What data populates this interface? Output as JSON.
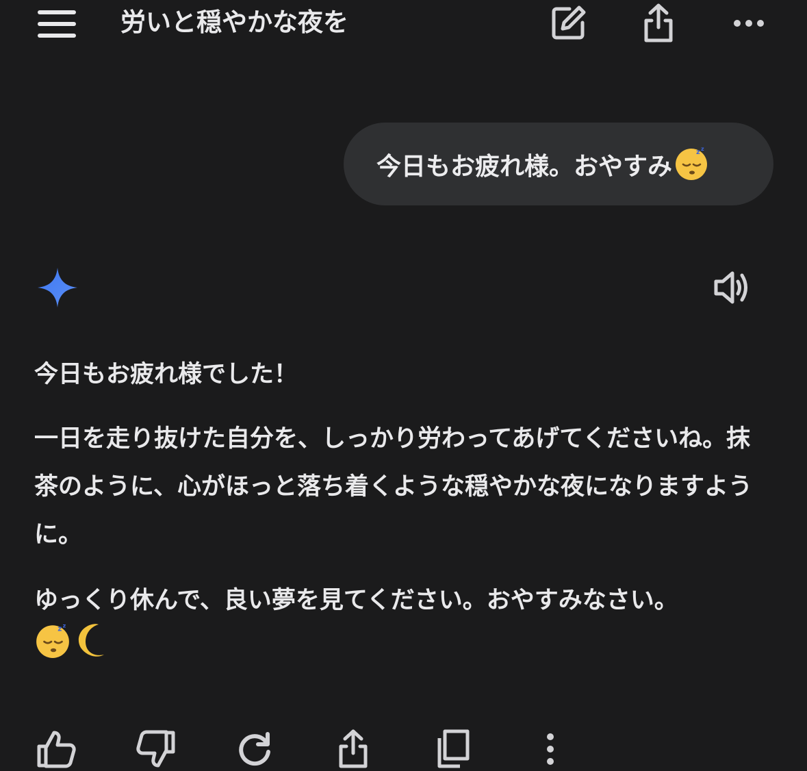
{
  "header": {
    "chat_title": "労いと穏やかな夜を",
    "icons": [
      "hamburger-menu-icon",
      "edit-icon",
      "share-icon",
      "more-horizontal-icon"
    ]
  },
  "user_message": {
    "text": "今日もお疲れ様。おやすみ",
    "emoji": "sleeping-face"
  },
  "response": {
    "paragraphs": [
      "今日もお疲れ様でした！",
      "一日を走り抜けた自分を、しっかり労わってあげてくださいね。抹茶のように、心がほっと落ち着くような穏やかな夜になりますように。",
      "ゆっくり休んで、良い夢を見てください。おやすみなさい。"
    ],
    "trailing_emojis": [
      "sleeping-face",
      "crescent-moon"
    ]
  },
  "colors": {
    "background": "#1b1b1c",
    "bubble": "#2f3032",
    "text": "#e9e9eb",
    "icon": "#d3d3d6",
    "gemini_blue": "#4a7cf0"
  },
  "action_bar": {
    "icons": [
      "thumbs-up-icon",
      "thumbs-down-icon",
      "regenerate-icon",
      "share-icon",
      "copy-icon",
      "more-vertical-icon"
    ]
  }
}
